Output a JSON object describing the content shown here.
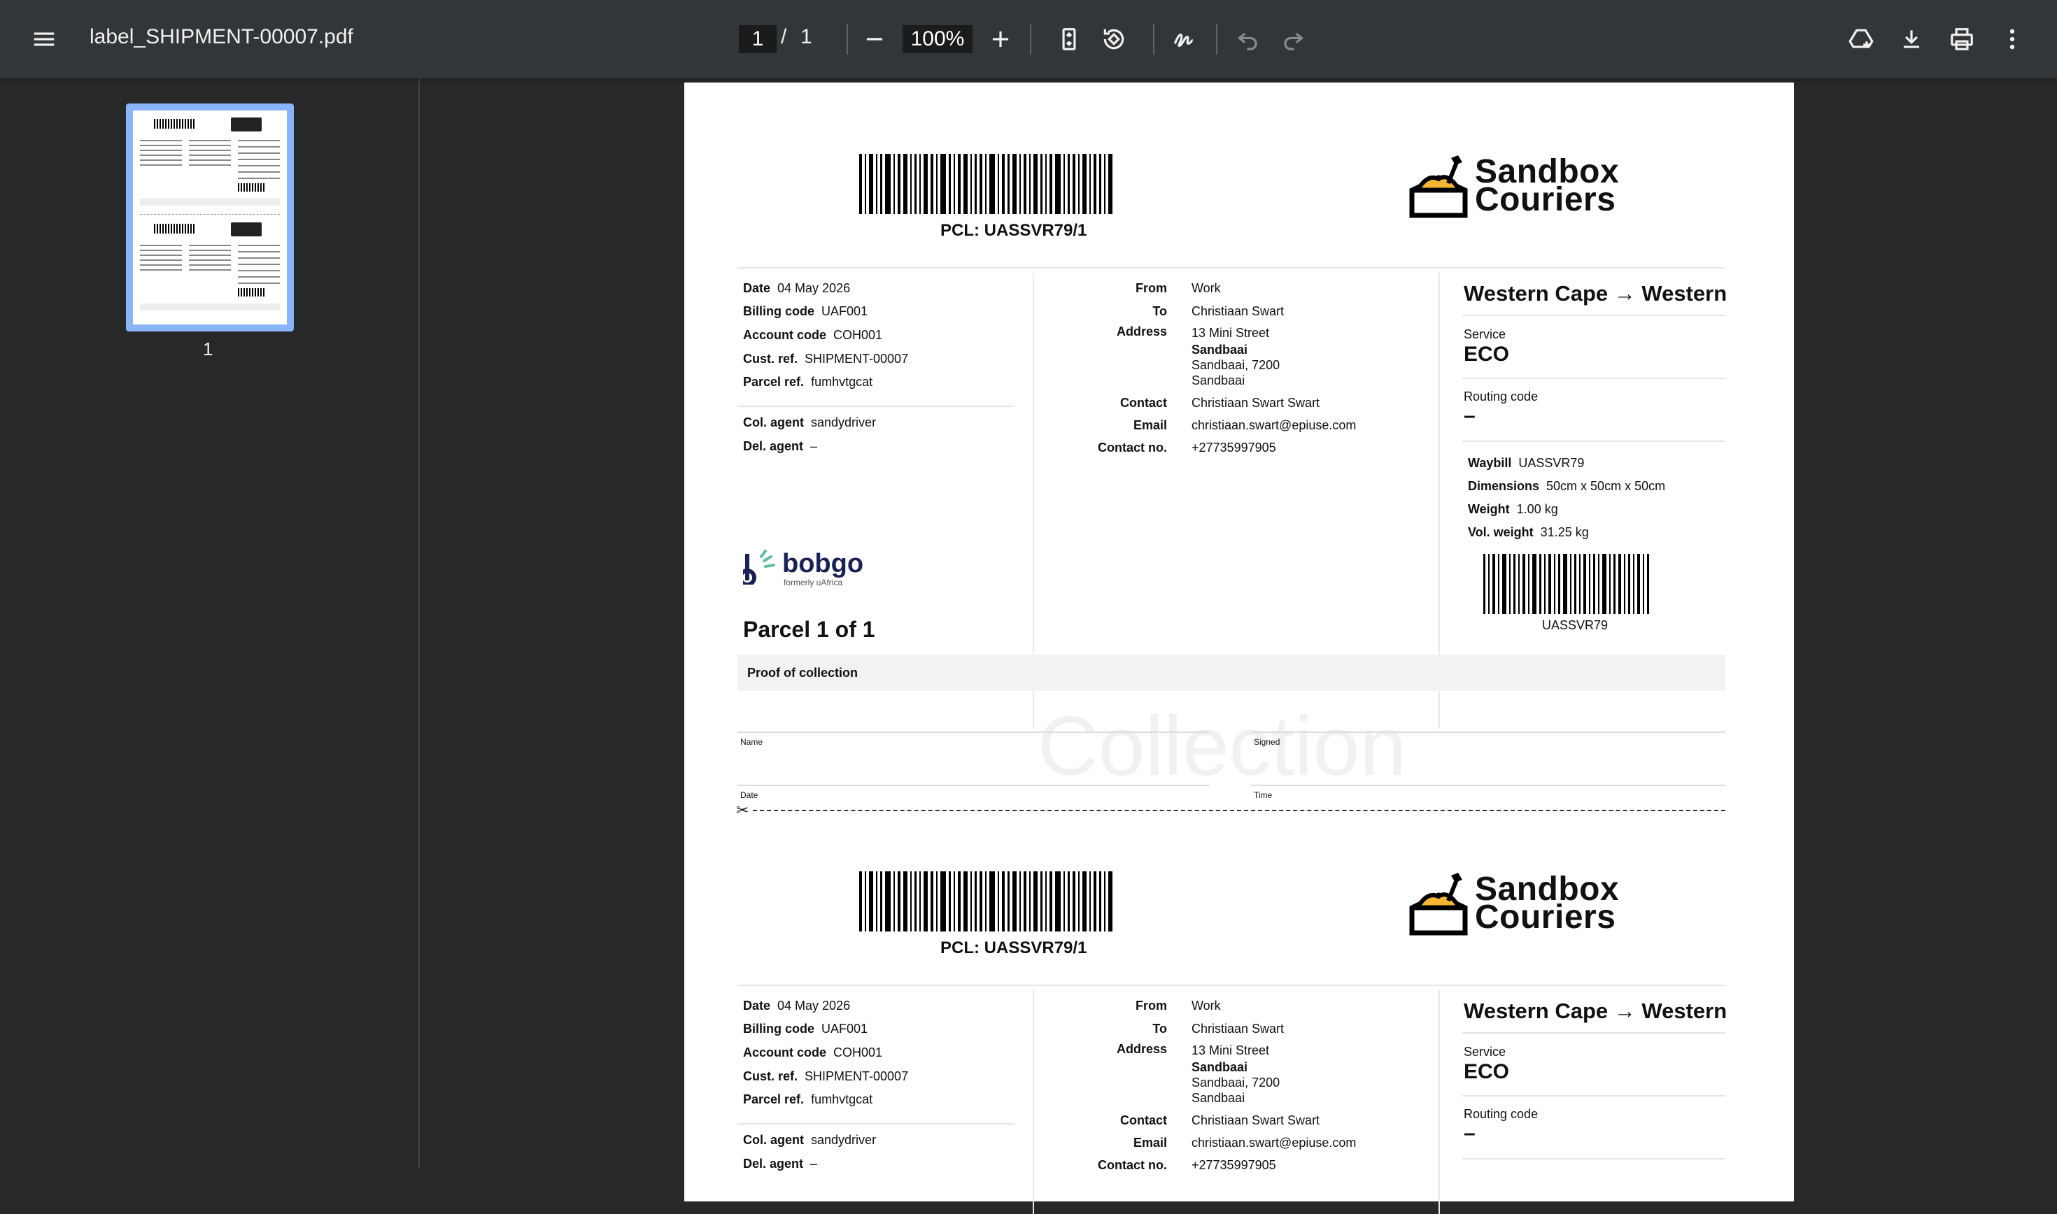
{
  "toolbar": {
    "file_name": "label_SHIPMENT-00007.pdf",
    "current_page": "1",
    "page_sep": "/",
    "total_pages": "1",
    "zoom": "100%"
  },
  "sidebar": {
    "thumb_page_number": "1"
  },
  "label": {
    "pcl": "PCL: UASSVR79/1",
    "logo_line1": "Sandbox",
    "logo_line2": "Couriers",
    "left": {
      "date_label": "Date",
      "date": "04 May 2026",
      "billing_label": "Billing code",
      "billing": "UAF001",
      "account_label": "Account code",
      "account": "COH001",
      "custref_label": "Cust. ref.",
      "custref": "SHIPMENT-00007",
      "parcelref_label": "Parcel ref.",
      "parcelref": "fumhvtgcat",
      "colagent_label": "Col. agent",
      "colagent": "sandydriver",
      "delagent_label": "Del. agent",
      "delagent": "–"
    },
    "middle": {
      "from_label": "From",
      "from": "Work",
      "to_label": "To",
      "to": "Christiaan Swart",
      "address_label": "Address",
      "addr1": "13 Mini Street",
      "addr2": "Sandbaai",
      "addr3": "Sandbaai, 7200",
      "addr4": "Sandbaai",
      "contact_label": "Contact",
      "contact": "Christiaan Swart Swart",
      "email_label": "Email",
      "email": "christiaan.swart@epiuse.com",
      "contactno_label": "Contact no.",
      "contactno": "+27735997905"
    },
    "right": {
      "route": "Western Cape → Western C",
      "service_label": "Service",
      "service": "ECO",
      "routing_label": "Routing code",
      "routing": "–",
      "waybill_label": "Waybill",
      "waybill": "UASSVR79",
      "dims_label": "Dimensions",
      "dims": "50cm x 50cm x 50cm",
      "weight_label": "Weight",
      "weight": "1.00 kg",
      "volweight_label": "Vol. weight",
      "volweight": "31.25 kg",
      "barcode_text": "UASSVR79"
    },
    "bobgo_name": "bobgo",
    "bobgo_sub": "formerly uAfrica",
    "parcel_count": "Parcel 1 of 1",
    "proof_title": "Proof of collection",
    "watermark": "Collection",
    "sig_name": "Name",
    "sig_signed": "Signed",
    "sig_date": "Date",
    "sig_time": "Time"
  }
}
